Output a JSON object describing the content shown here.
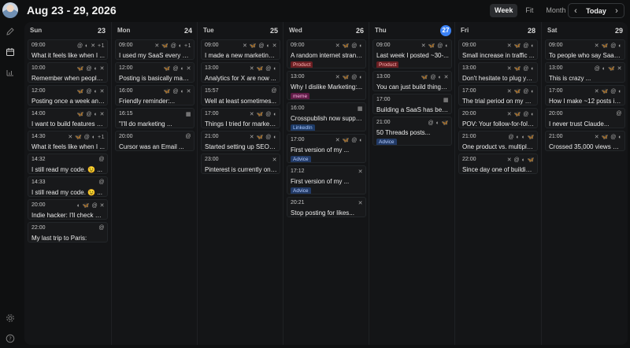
{
  "header": {
    "title": "Aug 23 - 29, 2026",
    "views": [
      "Week",
      "Fit",
      "Month"
    ],
    "active_view": "Week",
    "today_label": "Today",
    "prev_label": "‹",
    "next_label": "›"
  },
  "sidebar": {
    "icons": [
      "edit-icon",
      "calendar-icon",
      "analytics-icon"
    ],
    "bottom_icons": [
      "settings-icon",
      "help-icon"
    ]
  },
  "colors": {
    "accent": "#3b82f6",
    "product": "#6b1e22",
    "meme": "#5e1b45",
    "linkedin": "#1d3a66",
    "advice": "#223a66"
  },
  "days": [
    {
      "name": "Sun",
      "date": "23",
      "today": false,
      "posts": [
        {
          "time": "09:00",
          "icons": "@ ◐ ✕ +1",
          "text": "What it feels like when I ..."
        },
        {
          "time": "10:00",
          "icons": "🦋 @ ◐ ✕",
          "text": "Remember when people ..."
        },
        {
          "time": "12:00",
          "icons": "🦋 @ ◐ ✕",
          "text": "Posting once a week and ..."
        },
        {
          "time": "14:00",
          "icons": "🦋 @ ◐ ✕",
          "text": "I want to build features all ..."
        },
        {
          "time": "14:30",
          "icons": "✕ 🦋 @ ◐ +1",
          "text": "What it feels like when I ..."
        },
        {
          "time": "14:32",
          "icons": "@",
          "text": "I still read my code. 😉 ..."
        },
        {
          "time": "14:33",
          "icons": "@",
          "text": "I still read my code. 😉 ..."
        },
        {
          "time": "20:00",
          "icons": "◐ 🦋 @ ✕",
          "text": "Indie hacker: I'll check wit..."
        },
        {
          "time": "22:00",
          "icons": "@",
          "text": "My last trip to Paris:"
        }
      ]
    },
    {
      "name": "Mon",
      "date": "24",
      "today": false,
      "posts": [
        {
          "time": "09:00",
          "icons": "✕ 🦋 @ ◐ +1",
          "text": "I used my SaaS every day ..."
        },
        {
          "time": "12:00",
          "icons": "🦋 @ ◐ ✕",
          "text": "Posting is basically makin..."
        },
        {
          "time": "16:00",
          "icons": "🦋 @ ◐ ✕",
          "text": "Friendly reminder:..."
        },
        {
          "time": "16:15",
          "icons": "▦",
          "text": "\"I'll do marketing ..."
        },
        {
          "time": "20:00",
          "icons": "@",
          "text": "Cursor was an Email ..."
        }
      ]
    },
    {
      "name": "Tue",
      "date": "25",
      "today": false,
      "posts": [
        {
          "time": "09:00",
          "icons": "✕ 🦋 @ ◐ ✕",
          "text": "I made a new marketing ..."
        },
        {
          "time": "13:00",
          "icons": "✕ 🦋 @ ◐",
          "text": "Analytics for X are now ..."
        },
        {
          "time": "15:57",
          "icons": "@",
          "text": "Well at least sometimes..."
        },
        {
          "time": "17:00",
          "icons": "✕ 🦋 @ ◐",
          "text": "Things I tried for marketin..."
        },
        {
          "time": "21:00",
          "icons": "✕ 🦋 @ ◐",
          "text": "Started setting up SEO for..."
        },
        {
          "time": "23:00",
          "icons": "✕",
          "text": "Pinterest is currently on ..."
        }
      ]
    },
    {
      "name": "Wed",
      "date": "26",
      "today": false,
      "posts": [
        {
          "time": "09:00",
          "icons": "✕ 🦋 @ ◐",
          "text": "A random internet strange...",
          "tag": "Product",
          "tag_class": "tag-product"
        },
        {
          "time": "13:00",
          "icons": "✕ 🦋 @ ◐",
          "text": "Why I dislike Marketing:...",
          "tag": "meme",
          "tag_class": "tag-meme"
        },
        {
          "time": "16:00",
          "icons": "▦",
          "text": "Crosspublish now support...",
          "tag": "LinkedIn",
          "tag_class": "tag-linkedin"
        },
        {
          "time": "17:00",
          "icons": "✕ 🦋 @ ◐",
          "text": "First version of my ...",
          "tag": "Advice",
          "tag_class": "tag-advice"
        },
        {
          "time": "17:12",
          "icons": "✕",
          "text": "First version of my ...",
          "tag": "Advice",
          "tag_class": "tag-advice"
        },
        {
          "time": "20:21",
          "icons": "✕",
          "text": "Stop posting for likes..."
        }
      ]
    },
    {
      "name": "Thu",
      "date": "27",
      "today": true,
      "posts": [
        {
          "time": "09:00",
          "icons": "✕ 🦋 @ ◐",
          "text": "Last week I posted ~30-...",
          "tag": "Product",
          "tag_class": "tag-product"
        },
        {
          "time": "13:00",
          "icons": "🦋 @ ◐ ✕",
          "text": "You can just build things..."
        },
        {
          "time": "17:00",
          "icons": "▦",
          "text": "Building a SaaS has been ..."
        },
        {
          "time": "21:00",
          "icons": "@ ◐ 🦋",
          "text": "50 Threads posts...",
          "tag": "Advice",
          "tag_class": "tag-advice"
        }
      ]
    },
    {
      "name": "Fri",
      "date": "28",
      "today": false,
      "posts": [
        {
          "time": "09:00",
          "icons": "✕ 🦋 @ ◐",
          "text": "Small increase in traffic ..."
        },
        {
          "time": "13:00",
          "icons": "✕ 🦋 @ ◐",
          "text": "Don't hesitate to plug your..."
        },
        {
          "time": "17:00",
          "icons": "✕ 🦋 @ ◐",
          "text": "The trial period on my SaaS..."
        },
        {
          "time": "20:00",
          "icons": "✕ 🦋 @ ◐",
          "text": "POV: Your follow-for-follo..."
        },
        {
          "time": "21:00",
          "icons": "@ ◐ ◐ 🦋",
          "text": "One product vs. multiple, ..."
        },
        {
          "time": "22:00",
          "icons": "✕ @ ◐ 🦋",
          "text": "Since day one of building ..."
        }
      ]
    },
    {
      "name": "Sat",
      "date": "29",
      "today": false,
      "posts": [
        {
          "time": "09:00",
          "icons": "✕ 🦋 @ ◐",
          "text": "To people who say SaaS is..."
        },
        {
          "time": "13:00",
          "icons": "@ ◐ 🦋 ✕",
          "text": "This is crazy ..."
        },
        {
          "time": "17:00",
          "icons": "✕ 🦋 @ ◐",
          "text": "How I make ~12 posts in 1..."
        },
        {
          "time": "20:00",
          "icons": "@",
          "text": "I never trust Claude..."
        },
        {
          "time": "21:00",
          "icons": "✕ 🦋 @ ◐",
          "text": "Crossed 35,000 views on ..."
        }
      ]
    }
  ]
}
